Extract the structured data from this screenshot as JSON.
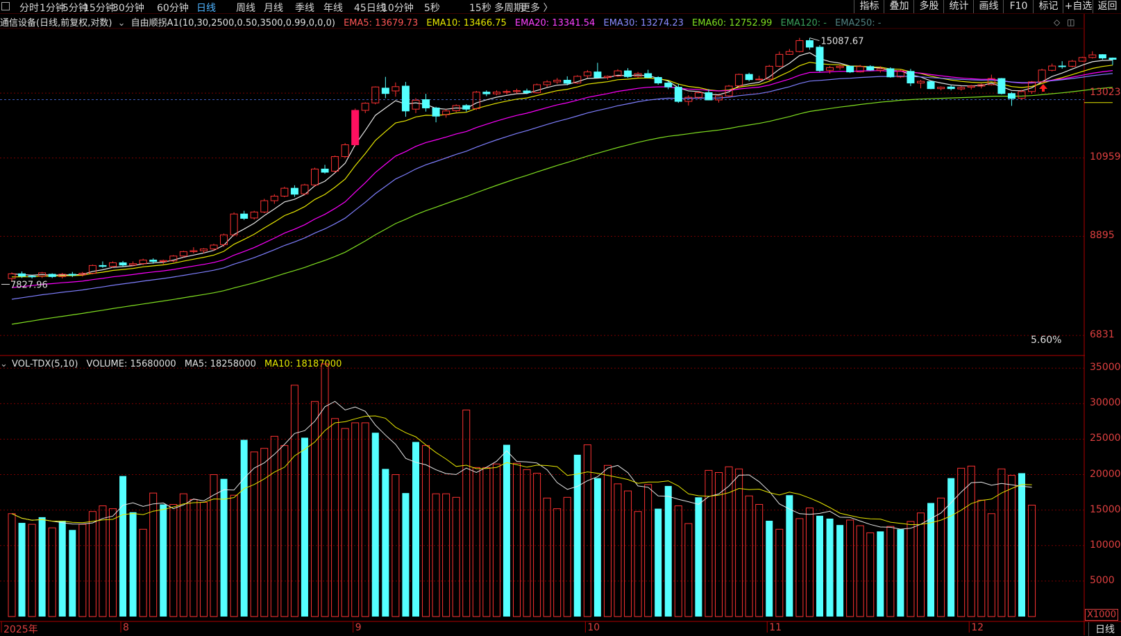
{
  "periods": [
    "分时",
    "1分钟",
    "5分钟",
    "15分钟",
    "30分钟",
    "60分钟",
    "日线",
    "周线",
    "月线",
    "季线",
    "年线",
    "45日线",
    "10分钟",
    "5秒",
    "15秒",
    "多周期",
    "更多 〉"
  ],
  "active_period": "日线",
  "tools": [
    "指标",
    "叠加",
    "多股",
    "统计",
    "画线",
    "F10",
    "标记",
    "+自选",
    "返回"
  ],
  "info": {
    "title": "通信设备(日线,前复权,对数)",
    "indicator": "自由顺拐A1(10,30,2500,0.50,3500,0.99,0,0,0)",
    "ema5": "EMA5: 13679.73",
    "ema10": "EMA10: 13466.75",
    "ema20": "EMA20: 13341.54",
    "ema30": "EMA30: 13274.23",
    "ema60": "EMA60: 12752.99",
    "ema120": "EMA120: -",
    "ema250": "EMA250: -"
  },
  "vol_info": {
    "name": "VOL-TDX(5,10)",
    "volume": "VOLUME: 15680000",
    "ma5": "MA5: 18258000",
    "ma10": "MA10: 18187000"
  },
  "price_axis": [
    "13023",
    "10959",
    "8895",
    "6831"
  ],
  "vol_axis": [
    "35000",
    "30000",
    "25000",
    "20000",
    "15000",
    "10000",
    "5000"
  ],
  "vol_unit": "X1000",
  "x_axis": [
    "2025年",
    "8",
    "9",
    "10",
    "11",
    "12"
  ],
  "bottom_right": "日线",
  "high_marker": "15087.67",
  "low_marker": "7827.96",
  "pct_label": "5.60%",
  "colors": {
    "up": "#ff3232",
    "down": "#54ffff",
    "ema5": "#e8e8e8",
    "ema10": "#e8e800",
    "ema20": "#ff00ff",
    "ema30": "#7f7fff",
    "ema60": "#80e020",
    "ma5": "#e8e8e8",
    "ma10": "#e8e800"
  },
  "chart_data": [
    {
      "type": "candlestick",
      "title": "通信设备(日线,前复权,对数)",
      "y_scale": "log",
      "ylim": [
        6500,
        15500
      ],
      "y_ticks": [
        13023,
        10959,
        8895,
        6831
      ],
      "candles": [
        [
          7950,
          8080,
          7880,
          8050
        ],
        [
          8050,
          8100,
          7960,
          8000
        ],
        [
          8000,
          8020,
          7950,
          7990
        ],
        [
          8000,
          8090,
          7960,
          8070
        ],
        [
          8040,
          8060,
          7960,
          7990
        ],
        [
          7990,
          8070,
          7950,
          8040
        ],
        [
          8040,
          8090,
          7980,
          8020
        ],
        [
          8030,
          8090,
          7990,
          8060
        ],
        [
          8060,
          8250,
          8040,
          8230
        ],
        [
          8230,
          8320,
          8180,
          8210
        ],
        [
          8210,
          8320,
          8180,
          8290
        ],
        [
          8290,
          8330,
          8200,
          8240
        ],
        [
          8240,
          8320,
          8220,
          8270
        ],
        [
          8270,
          8380,
          8240,
          8350
        ],
        [
          8350,
          8390,
          8270,
          8320
        ],
        [
          8320,
          8360,
          8260,
          8340
        ],
        [
          8330,
          8460,
          8300,
          8440
        ],
        [
          8440,
          8560,
          8410,
          8540
        ],
        [
          8540,
          8640,
          8500,
          8560
        ],
        [
          8560,
          8620,
          8500,
          8600
        ],
        [
          8600,
          8720,
          8560,
          8690
        ],
        [
          8700,
          8960,
          8650,
          8930
        ],
        [
          8930,
          9480,
          8900,
          9440
        ],
        [
          9440,
          9520,
          9290,
          9330
        ],
        [
          9340,
          9520,
          9300,
          9490
        ],
        [
          9490,
          9830,
          9460,
          9780
        ],
        [
          9780,
          9950,
          9700,
          9900
        ],
        [
          9900,
          10150,
          9870,
          10110
        ],
        [
          10110,
          10190,
          9880,
          9950
        ],
        [
          9960,
          10230,
          9920,
          10200
        ],
        [
          10200,
          10680,
          10150,
          10640
        ],
        [
          10640,
          10760,
          10510,
          10550
        ],
        [
          10580,
          11030,
          10540,
          11000
        ],
        [
          11000,
          11400,
          10960,
          11350
        ],
        [
          11350,
          12500,
          11300,
          12440
        ],
        [
          12440,
          12710,
          12350,
          12680
        ],
        [
          12690,
          13260,
          12640,
          13240
        ],
        [
          13200,
          13600,
          12850,
          13010
        ],
        [
          13100,
          13400,
          12900,
          13250
        ],
        [
          13270,
          13420,
          12230,
          12420
        ],
        [
          12480,
          12850,
          12350,
          12780
        ],
        [
          12800,
          13000,
          12400,
          12520
        ],
        [
          12520,
          12560,
          12050,
          12250
        ],
        [
          12300,
          12480,
          12200,
          12420
        ],
        [
          12430,
          12640,
          12380,
          12600
        ],
        [
          12600,
          12650,
          12400,
          12480
        ],
        [
          12500,
          13100,
          12450,
          13060
        ],
        [
          13060,
          13120,
          12920,
          13000
        ],
        [
          13000,
          13120,
          12950,
          13060
        ],
        [
          13060,
          13150,
          12980,
          13080
        ],
        [
          13080,
          13180,
          13010,
          13110
        ],
        [
          13100,
          13180,
          12990,
          13040
        ],
        [
          13040,
          13360,
          13010,
          13320
        ],
        [
          13320,
          13480,
          13230,
          13420
        ],
        [
          13420,
          13560,
          13350,
          13480
        ],
        [
          13480,
          13620,
          13300,
          13370
        ],
        [
          13380,
          13660,
          13350,
          13620
        ],
        [
          13640,
          13850,
          13560,
          13780
        ],
        [
          13780,
          14120,
          13700,
          13580
        ],
        [
          13580,
          13650,
          13500,
          13620
        ],
        [
          13630,
          13880,
          13600,
          13820
        ],
        [
          13820,
          13920,
          13560,
          13610
        ],
        [
          13620,
          13780,
          13570,
          13720
        ],
        [
          13720,
          13860,
          13550,
          13580
        ],
        [
          13580,
          13620,
          13320,
          13380
        ],
        [
          13380,
          13460,
          13160,
          13240
        ],
        [
          13230,
          13350,
          12690,
          12740
        ],
        [
          12740,
          12950,
          12600,
          12880
        ],
        [
          12880,
          13080,
          12820,
          13040
        ],
        [
          13040,
          13160,
          12780,
          12790
        ],
        [
          12790,
          12940,
          12700,
          12930
        ],
        [
          12930,
          13310,
          12900,
          13270
        ],
        [
          13280,
          13720,
          13210,
          13690
        ],
        [
          13690,
          13750,
          13440,
          13500
        ],
        [
          13500,
          13640,
          13470,
          13520
        ],
        [
          13520,
          14040,
          13480,
          13990
        ],
        [
          13990,
          14550,
          13960,
          14440
        ],
        [
          14440,
          14650,
          14420,
          14550
        ],
        [
          14550,
          15088,
          14520,
          14980
        ],
        [
          14980,
          15080,
          14620,
          14720
        ],
        [
          14720,
          14800,
          13780,
          13830
        ],
        [
          13840,
          14000,
          13720,
          13940
        ],
        [
          13940,
          14060,
          13860,
          13990
        ],
        [
          13990,
          14010,
          13740,
          13780
        ],
        [
          13780,
          14040,
          13760,
          13980
        ],
        [
          13980,
          14030,
          13820,
          13850
        ],
        [
          13840,
          13990,
          13760,
          13900
        ],
        [
          13900,
          13950,
          13570,
          13600
        ],
        [
          13600,
          13870,
          13560,
          13820
        ],
        [
          13800,
          13890,
          13270,
          13380
        ],
        [
          13380,
          13490,
          13190,
          13440
        ],
        [
          13430,
          13450,
          13160,
          13180
        ],
        [
          13180,
          13260,
          13120,
          13230
        ],
        [
          13240,
          13300,
          13120,
          13180
        ],
        [
          13170,
          13260,
          13110,
          13220
        ],
        [
          13230,
          13310,
          13150,
          13270
        ],
        [
          13270,
          13360,
          13190,
          13320
        ],
        [
          13320,
          13680,
          13290,
          13540
        ],
        [
          13540,
          13560,
          12980,
          13010
        ],
        [
          13010,
          13060,
          12590,
          12840
        ],
        [
          12850,
          13140,
          12800,
          13080
        ],
        [
          13080,
          13450,
          13000,
          13420
        ],
        [
          13420,
          13900,
          13380,
          13850
        ],
        [
          13840,
          14090,
          13800,
          14000
        ],
        [
          14000,
          14180,
          13900,
          13990
        ],
        [
          13990,
          14230,
          13950,
          14180
        ],
        [
          14180,
          14350,
          14160,
          14320
        ],
        [
          14320,
          14560,
          14280,
          14420
        ],
        [
          14430,
          14450,
          14240,
          14300
        ],
        [
          14300,
          14320,
          14040,
          14250
        ]
      ],
      "series": [
        {
          "name": "EMA5",
          "end_value": 13679.73
        },
        {
          "name": "EMA10",
          "end_value": 13466.75
        },
        {
          "name": "EMA20",
          "end_value": 13341.54
        },
        {
          "name": "EMA30",
          "end_value": 13274.23
        },
        {
          "name": "EMA60",
          "end_value": 12752.99
        }
      ]
    },
    {
      "type": "bar",
      "title": "VOL-TDX(5,10)",
      "ylabel": "X1000",
      "ylim": [
        0,
        36000
      ],
      "y_ticks": [
        35000,
        30000,
        25000,
        20000,
        15000,
        10000,
        5000
      ],
      "values": [
        14500,
        13200,
        13000,
        14000,
        12500,
        13500,
        12200,
        13000,
        14800,
        15600,
        15200,
        19800,
        14700,
        12300,
        17400,
        15800,
        15800,
        17300,
        16500,
        16100,
        20000,
        19400,
        17100,
        24900,
        23200,
        23700,
        25400,
        24100,
        32600,
        25200,
        30300,
        35600,
        27900,
        26500,
        27300,
        27300,
        25900,
        20800,
        20000,
        17400,
        24600,
        24100,
        17300,
        17300,
        16800,
        29100,
        21000,
        21000,
        21500,
        24200,
        21600,
        20700,
        20200,
        16700,
        15200,
        16800,
        22800,
        24200,
        19500,
        21300,
        18700,
        17700,
        14800,
        18600,
        15200,
        18400,
        15600,
        13100,
        16800,
        20600,
        20300,
        21100,
        20800,
        17000,
        15800,
        13500,
        12300,
        17100,
        13800,
        15300,
        14200,
        13800,
        12900,
        13600,
        12800,
        11800,
        12000,
        12700,
        12300,
        13400,
        14600,
        16000,
        16700,
        19500,
        20900,
        21200,
        16400,
        14500,
        20800,
        19900,
        20200,
        15700
      ],
      "up": [
        1,
        0,
        1,
        0,
        1,
        0,
        0,
        1,
        1,
        1,
        1,
        0,
        0,
        1,
        1,
        0,
        1,
        1,
        1,
        1,
        1,
        0,
        1,
        0,
        1,
        1,
        1,
        1,
        1,
        0,
        1,
        1,
        1,
        1,
        1,
        1,
        0,
        0,
        1,
        0,
        0,
        1,
        1,
        1,
        1,
        1,
        1,
        1,
        1,
        0,
        1,
        1,
        1,
        1,
        1,
        1,
        0,
        1,
        0,
        1,
        1,
        1,
        1,
        1,
        0,
        0,
        1,
        1,
        0,
        1,
        1,
        1,
        1,
        1,
        1,
        0,
        1,
        0,
        1,
        1,
        0,
        0,
        0,
        1,
        1,
        1,
        0,
        1,
        0,
        1,
        1,
        0,
        1,
        0,
        1,
        1,
        1,
        1,
        1,
        1,
        0,
        1
      ],
      "series": [
        {
          "name": "MA5",
          "end_value": 18258000
        },
        {
          "name": "MA10",
          "end_value": 18187000
        }
      ]
    }
  ]
}
